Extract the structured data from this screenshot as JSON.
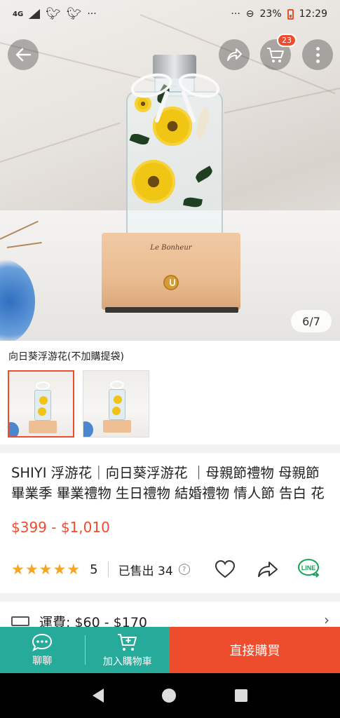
{
  "status_bar": {
    "network": "4G",
    "dots": "···",
    "right_dots": "···",
    "battery": "23%",
    "time": "12:29"
  },
  "hero": {
    "engraving": "Le Bonheur",
    "page_indicator": "6/7"
  },
  "header": {
    "cart_count": "23"
  },
  "variation": {
    "title": "向日葵浮游花(不加購提袋)",
    "thumbnails": [
      {
        "selected": true
      },
      {
        "selected": false
      }
    ]
  },
  "product": {
    "title": "SHIYI 浮游花｜向日葵浮游花 ｜母親節禮物 母親節 畢業季 畢業禮物 生日禮物 結婚禮物 情人節 告白 花 花禮",
    "price": "$399 - $1,010",
    "rating": "5",
    "stars": 5,
    "sold_label": "已售出 34"
  },
  "shipping": {
    "label": "運費: $60 - $170"
  },
  "bottom_bar": {
    "chat_label": "聊聊",
    "add_to_cart_label": "加入購物車",
    "buy_now_label": "直接購買"
  },
  "colors": {
    "accent": "#ee4d2d",
    "teal": "#26aa99",
    "star": "#f5a623"
  }
}
